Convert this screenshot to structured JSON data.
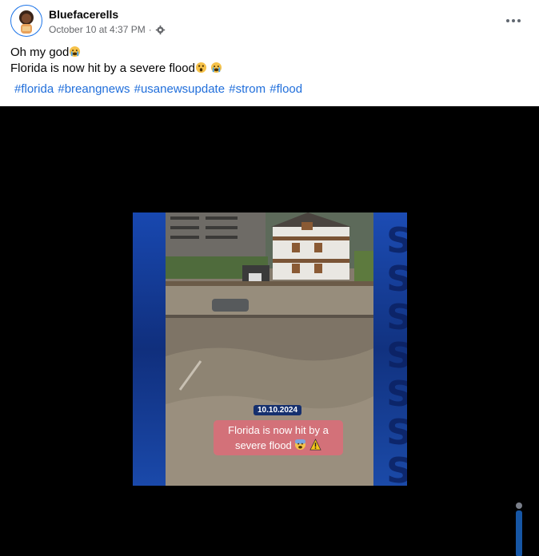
{
  "post": {
    "author": "Bluefacerells",
    "timestamp": "October 10 at 4:37 PM",
    "separator": "·",
    "privacy_icon": "gear-icon",
    "lines": [
      {
        "text": "Oh my god",
        "emoji": "crying-face"
      },
      {
        "text": "Florida is now hit by a severe flood",
        "emoji": "astonished-face crying-face"
      }
    ],
    "hashtags": [
      "#florida",
      "#breangnews",
      "#usanewsupdate",
      "#strom",
      "#flood"
    ]
  },
  "video": {
    "date_badge": "10.10.2024",
    "caption": "Florida is now hit by a severe flood",
    "caption_emoji": "fearful-face warning-sign"
  },
  "colors": {
    "link": "#216fdb",
    "avatar_ring": "#1a73e8",
    "video_bg": "#000000",
    "side_panel": "#1848b0"
  }
}
